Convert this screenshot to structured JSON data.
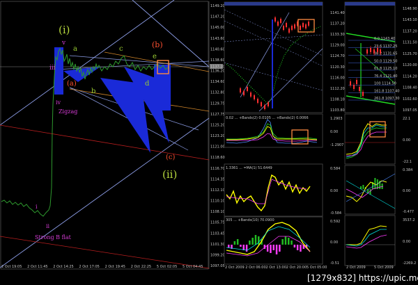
{
  "main_chart": {
    "y_axis_labels": [
      "1149.20",
      "1147.20",
      "1145.00",
      "1143.60",
      "1140.60",
      "1138.60",
      "1136.20",
      "1134.60",
      "1132.80",
      "1129.75",
      "1127.75",
      "1125.20",
      "1123.20",
      "1121.00",
      "1118.60",
      "1116.70",
      "1114.35",
      "1112.10",
      "1110.10",
      "1108.10",
      "1105.75",
      "1103.45",
      "1101.30",
      "1099.20",
      "1097.05"
    ],
    "price_label": "1137.20",
    "x_axis_labels": [
      "2 Oct 19:05",
      "2 Oct 11:45",
      "2 Oct 14:25",
      "2 Oct 17:05",
      "2 Oct 19:45",
      "2 Oct 22:25",
      "5 Oct 02:05",
      "5 Oct 04:45"
    ],
    "labels": {
      "wave_i_big": "(i)",
      "wave_ii_big": "(ii)",
      "v": "v",
      "iii": "iii",
      "iv": "iv",
      "a_paren": "(a)",
      "a": "a",
      "b": "b",
      "c": "c",
      "d": "d",
      "e": "e",
      "b_paren": "(b)",
      "c_paren": "(c)",
      "zigzag": "Zigzag",
      "i_small": "i",
      "ii_small": "ii",
      "strong_b_flat": "Strong B flat"
    },
    "colors": {
      "box": "#1a2ad8",
      "green": "#9acd32",
      "pink": "#d63cd6",
      "red": "#ff5030",
      "price": "#2e8b2e"
    }
  },
  "mid_top": {
    "y_axis_labels": [
      "1141.40",
      "1137.20",
      "1133.30",
      "1129.00",
      "1124.70",
      "1120.30",
      "1116.00",
      "1112.20",
      "1108.10",
      "1103.80"
    ]
  },
  "mid_ind1": {
    "header": "0.02 ... +Bands(2) 0.0105 ... +Bands(2) 0.0066",
    "scale_labels": [
      "1.2903",
      "0.00",
      "-1.2907"
    ]
  },
  "mid_ind2": {
    "header": "1.3361 ... =MA(1) 51.6449",
    "scale_labels": [
      "0.584",
      "0.00",
      "-0.584"
    ]
  },
  "mid_ind3": {
    "header": "305 ... +Bands(10) 70.0900",
    "scale_labels": [
      "0.592",
      "0.00",
      "-0.51"
    ]
  },
  "mid_x_axis_labels": [
    "2 Oct 2009",
    "2 Oct 06:00",
    "2 Oct 13:00",
    "2 Oct 20:00",
    "5 Oct 05:00"
  ],
  "right_top": {
    "y_axis_labels": [
      "1148.90",
      "1143.10",
      "1137.20",
      "1131.50",
      "1125.70",
      "1120.00",
      "1114.20",
      "1108.40",
      "1102.60",
      "1097.05"
    ],
    "fib_labels": [
      "0.0 1143.40",
      "23.6 1137.25",
      "38.2 1131.65",
      "50.0 1129.50",
      "61.8 1125.10",
      "76.4 1121.40",
      "100 1114.50",
      "161.8 1107.40",
      "261.8 1097.30"
    ]
  },
  "right_ind1": {
    "scale_labels": [
      "22.1",
      "0.00",
      "-22.1"
    ]
  },
  "right_ind2": {
    "scale_labels": [
      "0.384",
      "0.00",
      "-0.477"
    ]
  },
  "right_ind3": {
    "scale_labels": [
      "3537.2",
      "0.00",
      "-2269.2"
    ]
  },
  "right_x_axis_labels": [
    "2 Oct 2009",
    "5 Oct 2009"
  ],
  "footer": "[1279x832] https://upic.me/"
}
